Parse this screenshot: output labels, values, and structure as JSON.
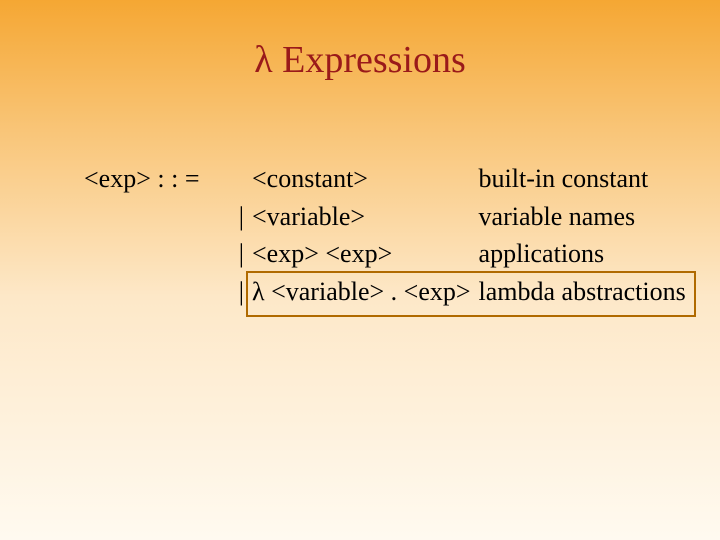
{
  "title": "λ Expressions",
  "grammar": {
    "lhs": "<exp>",
    "operator": ": : =",
    "rules": [
      {
        "bar": "",
        "production": "<constant>",
        "description": "built-in constant"
      },
      {
        "bar": "|",
        "production": " <variable>",
        "description": "variable names"
      },
      {
        "bar": "|",
        "production": "<exp> <exp>",
        "description": "applications"
      },
      {
        "bar": "|",
        "production": "λ <variable> . <exp>",
        "description": "lambda abstractions"
      }
    ]
  }
}
